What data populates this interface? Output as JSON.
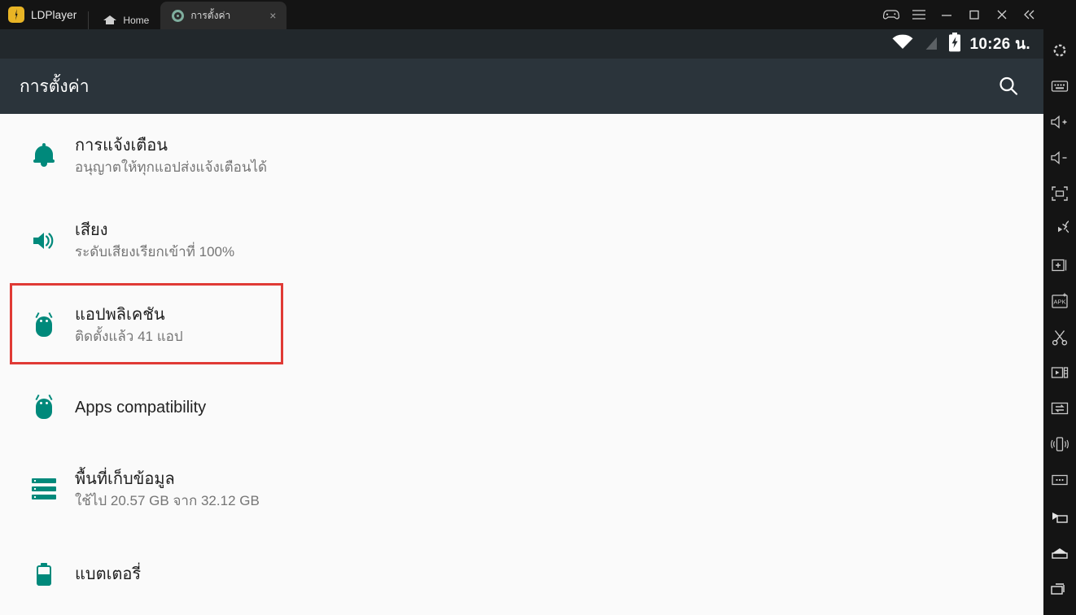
{
  "window": {
    "brand": "LDPlayer",
    "tabs": [
      {
        "label": "Home",
        "icon": "home-icon",
        "active": false
      },
      {
        "label": "การตั้งค่า",
        "icon": "settings-gear-icon",
        "active": true,
        "close": "×"
      }
    ],
    "controls": [
      {
        "name": "gamepad-icon",
        "label": ""
      },
      {
        "name": "menu-icon",
        "label": ""
      },
      {
        "name": "minimize-icon",
        "label": ""
      },
      {
        "name": "maximize-icon",
        "label": ""
      },
      {
        "name": "close-icon",
        "label": ""
      },
      {
        "name": "collapse-icon",
        "label": ""
      }
    ]
  },
  "statusbar": {
    "time": "10:26 น.",
    "icons": [
      "wifi-icon",
      "signal-off-icon",
      "battery-charging-icon"
    ]
  },
  "settings_header": {
    "title": "การตั้งค่า",
    "search_icon": "search-icon"
  },
  "list": {
    "items": [
      {
        "name": "notifications",
        "icon": "bell-icon",
        "title": "การแจ้งเตือน",
        "subtitle": "อนุญาตให้ทุกแอปส่งแจ้งเตือนได้",
        "highlighted": false
      },
      {
        "name": "sound",
        "icon": "volume-icon",
        "title": "เสียง",
        "subtitle": "ระดับเสียงเรียกเข้าที่ 100%",
        "highlighted": false
      },
      {
        "name": "apps",
        "icon": "android-icon",
        "title": "แอปพลิเคชัน",
        "subtitle": "ติดตั้งแล้ว 41 แอป",
        "highlighted": true
      },
      {
        "name": "apps-compatibility",
        "icon": "android-icon",
        "title": "Apps compatibility",
        "subtitle": "",
        "highlighted": false
      },
      {
        "name": "storage",
        "icon": "storage-icon",
        "title": "พื้นที่เก็บข้อมูล",
        "subtitle": "ใช้ไป 20.57 GB จาก 32.12 GB",
        "highlighted": false
      },
      {
        "name": "battery",
        "icon": "battery-icon",
        "title": "แบตเตอรี่",
        "subtitle": "",
        "highlighted": false
      }
    ]
  },
  "sidebar": {
    "top_buttons": [
      "settings-gear-icon",
      "keyboard-icon",
      "volume-up-icon",
      "volume-down-icon",
      "fullscreen-icon",
      "rotate-icon",
      "add-instance-icon",
      "install-apk-icon",
      "scissors-icon",
      "video-record-icon",
      "file-transfer-icon",
      "shake-icon",
      "more-options-icon"
    ],
    "bottom_buttons": [
      "back-icon",
      "home-icon",
      "recents-icon"
    ]
  },
  "colors": {
    "accent_teal": "#00897b",
    "highlight_red": "#e03a35",
    "header_dark": "#2b343b",
    "statusbar_dark": "#22282c",
    "brand_yellow": "#e8b425"
  }
}
